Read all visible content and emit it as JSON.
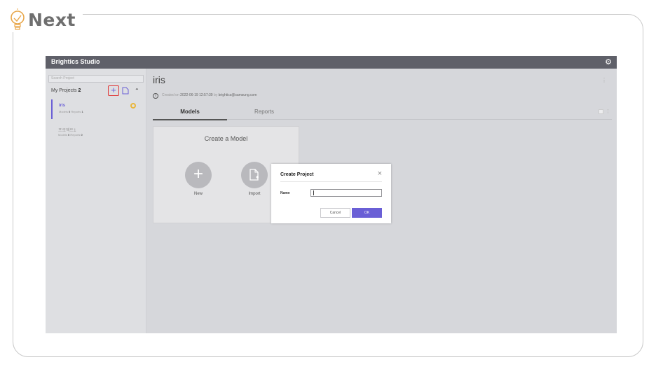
{
  "brand": {
    "logo_text": "Next"
  },
  "app": {
    "title": "Brightics Studio"
  },
  "sidebar": {
    "search_placeholder": "Search Project",
    "my_projects_label": "My Projects",
    "project_count": "2",
    "projects": [
      {
        "name": "iris",
        "models_label": "Models",
        "models_count": "0",
        "reports_label": "Reports",
        "reports_count": "1",
        "active": true
      },
      {
        "name": "프로젝트1",
        "models_label": "Models",
        "models_count": "0",
        "reports_label": "Reports",
        "reports_count": "0",
        "active": false
      }
    ]
  },
  "main": {
    "project_title": "iris",
    "created_label": "Created on",
    "created_date": "2022-06-19 12:57:39",
    "by_label": "by",
    "created_by": "brightics@samsung.com",
    "tabs": [
      {
        "label": "Models"
      },
      {
        "label": "Reports"
      }
    ],
    "create_model": {
      "title": "Create a Model",
      "new_label": "New",
      "import_label": "Import"
    }
  },
  "dialog": {
    "title": "Create Project",
    "name_label": "Name",
    "name_value": "",
    "cancel_label": "Cancel",
    "ok_label": "OK"
  },
  "colors": {
    "accent": "#6a5fd6",
    "titlebar": "#5f6069",
    "highlight_border": "#e03a3a",
    "star": "#e9b63b"
  }
}
